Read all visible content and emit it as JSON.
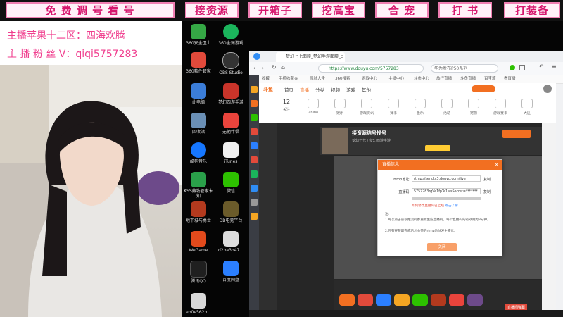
{
  "overlay": {
    "buttons": [
      "免 费 调 号 看 号",
      "接资源",
      "开箱子",
      "挖高宝",
      "合 宠",
      "打 书",
      "打装备"
    ],
    "info_line1": "主播苹果十二区：四海欢腾",
    "info_line2": "主 播 粉 丝 V：qiqi5757283",
    "accent": "#f07fb2",
    "text_color": "#d6166d"
  },
  "desktop": {
    "icons": [
      {
        "label": "360安全卫士",
        "color": "#35a845"
      },
      {
        "label": "360全洲游戏",
        "color": "#1bb55c"
      },
      {
        "label": "360软件管家",
        "color": "#e24a3b"
      },
      {
        "label": "OBS Studio",
        "color": "#333333"
      },
      {
        "label": "此电脑",
        "color": "#3b7dd8"
      },
      {
        "label": "梦幻西游手游",
        "color": "#c9342a"
      },
      {
        "label": "回收站",
        "color": "#6a8fb5"
      },
      {
        "label": "无他伴侣",
        "color": "#e9443c"
      },
      {
        "label": "酷狗音乐",
        "color": "#1677ff"
      },
      {
        "label": "iTunes",
        "color": "#f0f0f0"
      },
      {
        "label": "KSS藏坊管家未知",
        "color": "#2aa04a"
      },
      {
        "label": "微信",
        "color": "#2dc100"
      },
      {
        "label": "地下城与勇士",
        "color": "#b33a1e"
      },
      {
        "label": "DB电竞平台",
        "color": "#6b5b2a"
      },
      {
        "label": "WeGame",
        "color": "#e24a1c"
      },
      {
        "label": "d2ba3b47...",
        "color": "#dddddd"
      },
      {
        "label": "腾讯QQ",
        "color": "#1f1f1f"
      },
      {
        "label": "百度网盘",
        "color": "#2b7fff"
      },
      {
        "label": "eb0e562b...",
        "color": "#d9d9d9"
      }
    ]
  },
  "browser": {
    "tab_title": "梦幻七七面膜_梦幻手游面膜_c",
    "url": "https://www.douyu.com/5757283",
    "search_placeholder": "华为发布P50系列",
    "bookmarks": [
      "收藏",
      "手机收藏夹",
      "网址大全",
      "360搜索",
      "游戏中心",
      "主播中心",
      "斗鱼中心",
      "旅行直播",
      "斗鱼直播",
      "百宝箱",
      "看直播"
    ],
    "site_nav": [
      "首页",
      "直播",
      "分类",
      "视频",
      "游戏",
      "其他"
    ],
    "site_logo": "斗鱼",
    "categories": [
      "12",
      "关注",
      "Zhibo",
      "娱乐",
      "游戏资讯",
      "赛事",
      "鱼乐",
      "活动",
      "宠物",
      "游戏赛事",
      "大区"
    ],
    "room_title": "接资源结号找号",
    "room_sub": "梦幻七七 / 梦幻西游手游",
    "dialog": {
      "title": "直播信息",
      "close": "×",
      "rtmp_label": "rtmp地址:",
      "rtmp_value": "rtmp://sendtc3.douyu.com/live",
      "code_label": "直播码:",
      "code_value": "5757283rgVe1fpTe1wsSecret=*******",
      "copy": "复制",
      "refresh_hint": "如何修改直播码已上线",
      "more_link": "点击了解",
      "note_title": "注:",
      "note1": "1.每次点击获取推流码都重新生成直播码，每个直播码的有效期为3分钟。",
      "note2": "2.只有在获取完成后才会带的rtmp地址发生变化。",
      "ok": "关闭"
    },
    "footer_badge": "直播间弹幕"
  }
}
